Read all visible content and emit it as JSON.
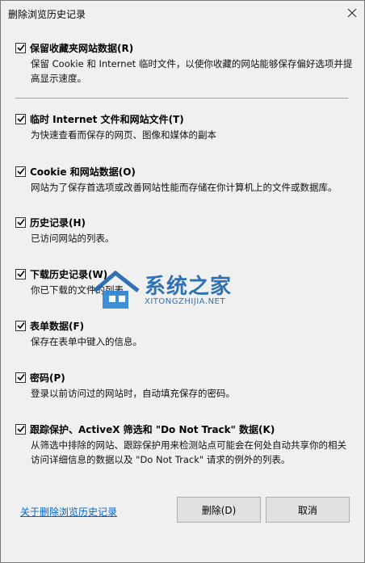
{
  "window": {
    "title": "删除浏览历史记录",
    "close_icon": "close-icon"
  },
  "items": [
    {
      "label": "保留收藏夹网站数据(R)",
      "checked": true,
      "desc": "保留 Cookie 和 Internet 临时文件，以使你收藏的网站能够保存偏好选项并提高显示速度。"
    },
    {
      "label": "临时 Internet 文件和网站文件(T)",
      "checked": true,
      "desc": "为快速查看而保存的网页、图像和媒体的副本"
    },
    {
      "label": "Cookie 和网站数据(O)",
      "checked": true,
      "desc": "网站为了保存首选项或改善网站性能而存储在你计算机上的文件或数据库。"
    },
    {
      "label": "历史记录(H)",
      "checked": true,
      "desc": "已访问网站的列表。"
    },
    {
      "label": "下载历史记录(W)",
      "checked": true,
      "desc": "你已下载的文件的列表。"
    },
    {
      "label": "表单数据(F)",
      "checked": true,
      "desc": "保存在表单中键入的信息。"
    },
    {
      "label": "密码(P)",
      "checked": true,
      "desc": "登录以前访问过的网站时，自动填充保存的密码。"
    },
    {
      "label": "跟踪保护、ActiveX 筛选和 \"Do Not Track\" 数据(K)",
      "checked": true,
      "desc": "从筛选中排除的网站、跟踪保护用来检测站点可能会在何处自动共享你的相关访问详细信息的数据以及 \"Do Not Track\" 请求的例外的列表。"
    }
  ],
  "watermark": {
    "title": "系统之家",
    "subtitle": "XITONGZHIJIA.NET"
  },
  "footer": {
    "link": "关于删除浏览历史记录",
    "delete_label": "删除(D)",
    "cancel_label": "取消"
  }
}
